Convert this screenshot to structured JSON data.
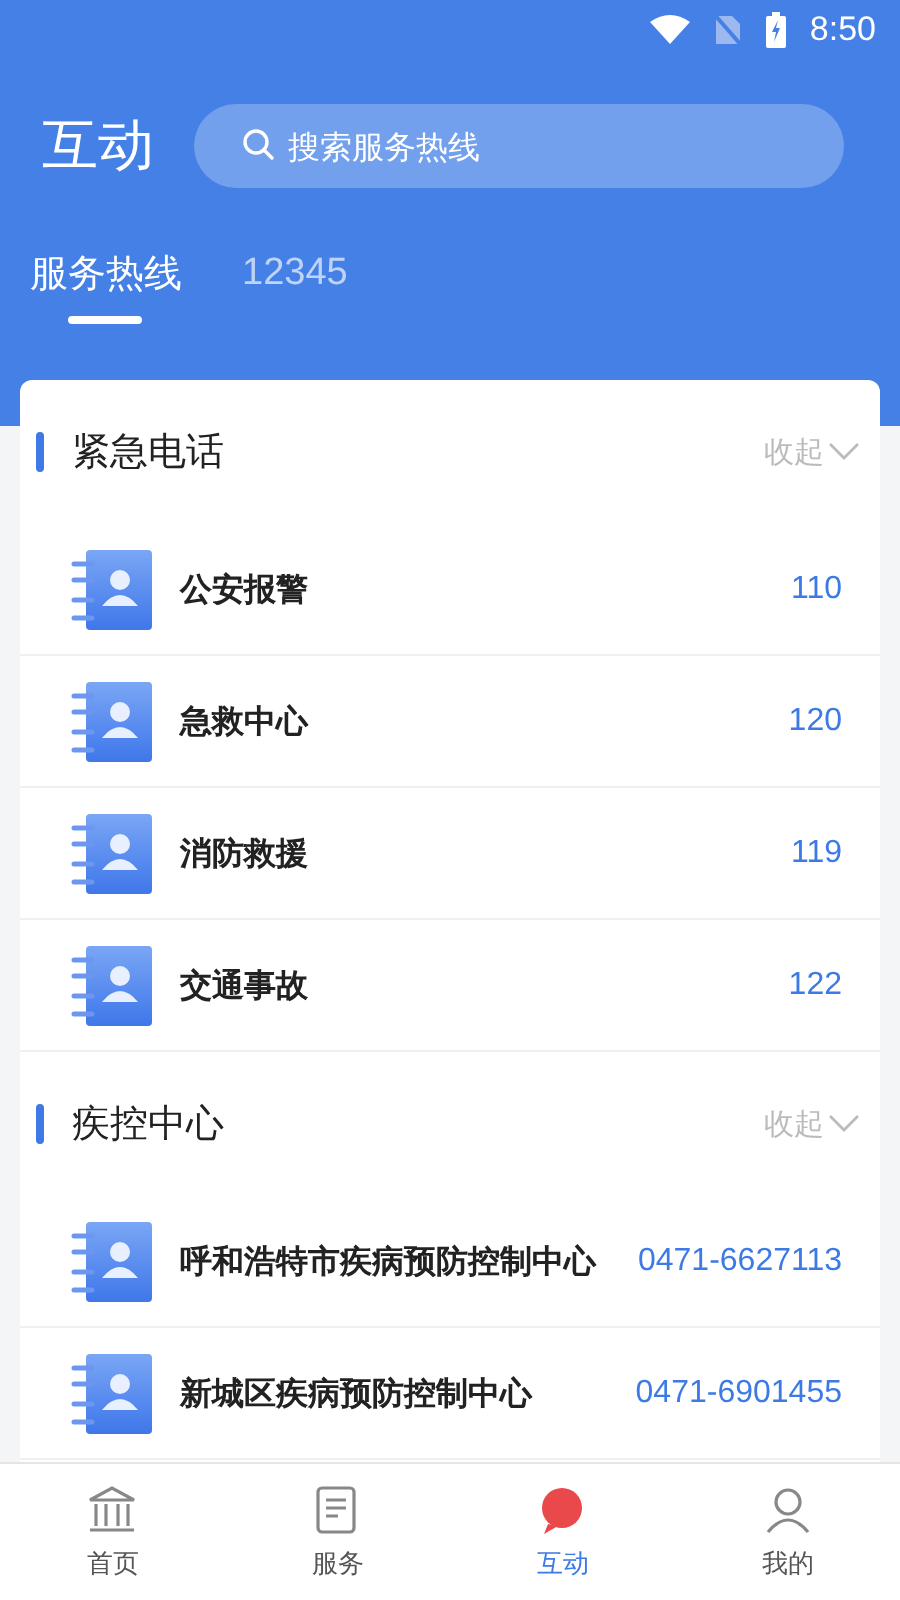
{
  "status_bar": {
    "time": "8:50"
  },
  "header": {
    "title": "互动",
    "search": {
      "placeholder": "搜索服务热线"
    }
  },
  "tabs": [
    {
      "label": "服务热线",
      "selected": true
    },
    {
      "label": "12345",
      "selected": false
    }
  ],
  "sections": [
    {
      "title": "紧急电话",
      "toggle_label": "收起",
      "items": [
        {
          "name": "公安报警",
          "phone": "110"
        },
        {
          "name": "急救中心",
          "phone": "120"
        },
        {
          "name": "消防救援",
          "phone": "119"
        },
        {
          "name": "交通事故",
          "phone": "122"
        }
      ]
    },
    {
      "title": "疾控中心",
      "toggle_label": "收起",
      "items": [
        {
          "name": "呼和浩特市疾病预防控制中心",
          "phone": "0471-6627113"
        },
        {
          "name": "新城区疾病预防控制中心",
          "phone": "0471-6901455"
        }
      ]
    }
  ],
  "bottom_nav": [
    {
      "label": "首页",
      "selected": false
    },
    {
      "label": "服务",
      "selected": false
    },
    {
      "label": "互动",
      "selected": true
    },
    {
      "label": "我的",
      "selected": false
    }
  ]
}
